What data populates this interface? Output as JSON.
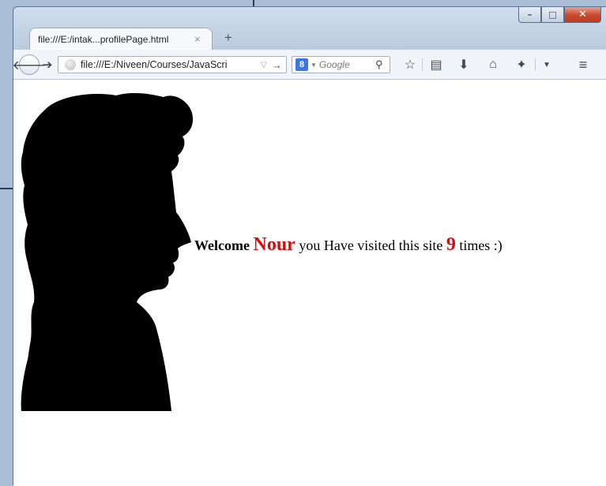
{
  "window": {
    "minimize": "–",
    "maximize": "□",
    "close": "✕"
  },
  "tab": {
    "title": "file:///E:/intak...profilePage.html",
    "close": "×",
    "new_tab": "+"
  },
  "navbar": {
    "url": "file:///E:/Niveen/Courses/JavaScri",
    "search_placeholder": "Google",
    "search_engine_logo": "8",
    "icons": [
      "back-icon",
      "forward-icon",
      "globe-icon",
      "go-arrow-icon",
      "search-icon",
      "bookmark-star-icon",
      "reading-list-icon",
      "download-icon",
      "home-icon",
      "addon-icon",
      "menu-icon"
    ]
  },
  "content": {
    "welcome_label": "Welcome",
    "user_name": "Nour",
    "visited_text": "you Have visited this site",
    "visit_count": "9",
    "suffix": "times :)"
  },
  "colors": {
    "highlight": "#d01010"
  }
}
